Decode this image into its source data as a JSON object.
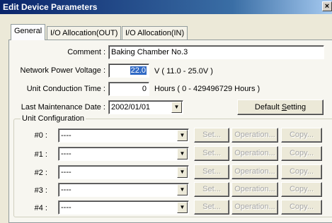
{
  "window": {
    "title": "Edit Device Parameters",
    "close_glyph": "×"
  },
  "tabs": [
    {
      "label": "General",
      "active": true
    },
    {
      "label": "I/O Allocation(OUT)",
      "active": false
    },
    {
      "label": "I/O Allocation(IN)",
      "active": false
    }
  ],
  "comment": {
    "label": "Comment :",
    "value": "Baking Chamber No.3"
  },
  "network_power": {
    "label": "Network Power Voltage :",
    "value": "22.0",
    "unit_range": "V ( 11.0 - 25.0V )"
  },
  "conduction_time": {
    "label": "Unit Conduction Time :",
    "value": "0",
    "unit_range": "Hours ( 0 - 429496729 Hours )"
  },
  "maintenance": {
    "label": "Last Maintenance Date :",
    "value": "2002/01/01"
  },
  "default_setting_button": {
    "label_pre": "Default ",
    "label_accel": "S",
    "label_post": "etting"
  },
  "unit_config": {
    "title": "Unit Configuration",
    "rows": [
      {
        "label": "#0 :",
        "value": "----"
      },
      {
        "label": "#1 :",
        "value": "----"
      },
      {
        "label": "#2 :",
        "value": "----"
      },
      {
        "label": "#3 :",
        "value": "----"
      },
      {
        "label": "#4 :",
        "value": "----"
      }
    ],
    "set_label": "Set...",
    "operation_label": "Operation...",
    "copy_label": "Copy..."
  }
}
